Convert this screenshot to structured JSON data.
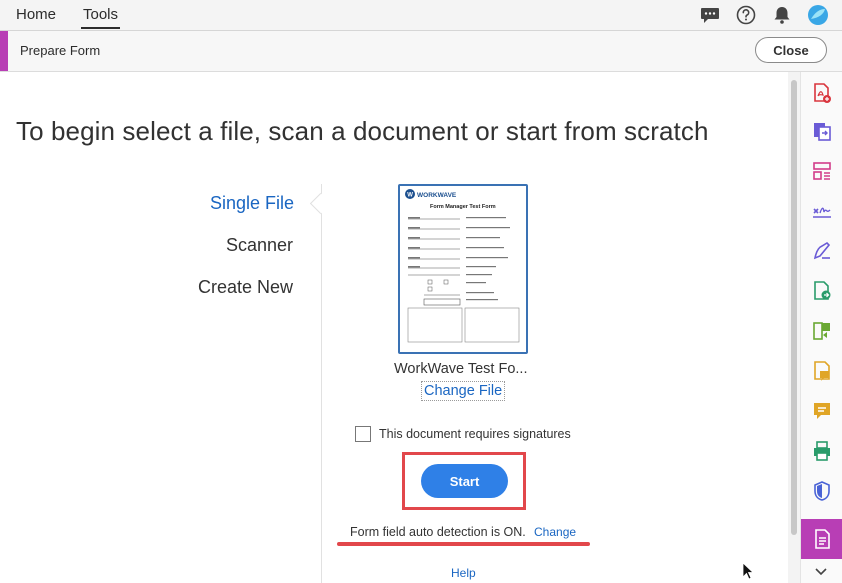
{
  "topbar": {
    "tabs": [
      {
        "label": "Home",
        "active": false
      },
      {
        "label": "Tools",
        "active": true
      }
    ],
    "icons": [
      "chat-icon",
      "help-icon",
      "bell-icon",
      "account-avatar"
    ]
  },
  "toolbar": {
    "title": "Prepare Form",
    "close_label": "Close",
    "accent_color": "#b83eb5"
  },
  "main": {
    "headline": "To begin select a file, scan a document or start from scratch",
    "sources": [
      {
        "label": "Single File",
        "selected": true
      },
      {
        "label": "Scanner",
        "selected": false
      },
      {
        "label": "Create New",
        "selected": false
      }
    ],
    "file": {
      "thumbnail_logo": "WORKWAVE",
      "thumbnail_title": "Form Manager Test Form",
      "name": "WorkWave Test Fo...",
      "change_label": "Change File"
    },
    "signature_checkbox": {
      "label": "This document requires signatures",
      "checked": false
    },
    "start_label": "Start",
    "auto_detect_text": "Form field auto detection is ON.",
    "auto_detect_change": "Change",
    "help_label": "Help"
  },
  "colors": {
    "accent": "#b83eb5",
    "link": "#1a66c2",
    "primary_button": "#2f80e7",
    "annotation_red": "#e2474b"
  },
  "rail": {
    "icons": [
      "create-pdf-icon",
      "export-pdf-icon",
      "organize-pages-icon",
      "fill-sign-icon",
      "request-signature-icon",
      "send-for-review-icon",
      "compress-pdf-icon",
      "comment-icon",
      "add-comment-icon",
      "print-production-icon",
      "protect-icon",
      "prepare-form-icon"
    ],
    "active": "prepare-form-icon"
  }
}
